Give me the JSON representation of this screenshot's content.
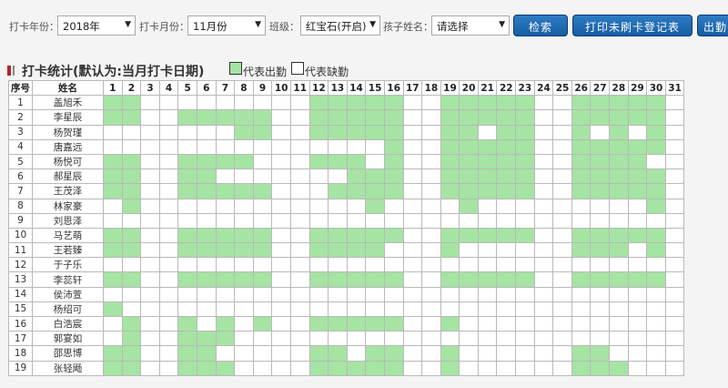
{
  "filters": {
    "year_label": "打卡年份：",
    "year_value": "2018年",
    "month_label": "打卡月份：",
    "month_value": "11月份",
    "class_label": "班级：",
    "class_value": "红宝石(开启)",
    "child_label": "孩子姓名：",
    "child_value": "请选择",
    "search_button": "检索",
    "print_button": "打印未刷卡登记表",
    "export_button": "出勤"
  },
  "section": {
    "title": "打卡统计(默认为:当月打卡日期)",
    "legend_present": "代表出勤",
    "legend_absent": "代表缺勤"
  },
  "colors": {
    "present": "#a5e4a3",
    "absent": "#ffffff",
    "button": "#1f6db8"
  },
  "table": {
    "header_no": "序号",
    "header_name": "姓名",
    "days": [
      "1",
      "2",
      "3",
      "4",
      "5",
      "6",
      "7",
      "8",
      "9",
      "10",
      "11",
      "12",
      "13",
      "14",
      "15",
      "16",
      "17",
      "18",
      "19",
      "20",
      "21",
      "22",
      "23",
      "24",
      "25",
      "26",
      "27",
      "28",
      "29",
      "30",
      "31"
    ],
    "rows": [
      {
        "no": "1",
        "name": "盖旭禾",
        "present": [
          1,
          2,
          12,
          13,
          14,
          15,
          16,
          19,
          20,
          21,
          22,
          23,
          26,
          27,
          28,
          29,
          30
        ]
      },
      {
        "no": "2",
        "name": "李星辰",
        "present": [
          1,
          2,
          5,
          6,
          7,
          8,
          9,
          12,
          13,
          14,
          15,
          16,
          19,
          20,
          21,
          22,
          23,
          26,
          27,
          28,
          29,
          30
        ]
      },
      {
        "no": "3",
        "name": "杨贺瑾",
        "present": [
          8,
          9,
          12,
          13,
          14,
          15,
          16,
          19,
          20,
          22,
          23,
          26,
          28,
          30
        ]
      },
      {
        "no": "4",
        "name": "唐嘉远",
        "present": [
          16,
          19,
          20,
          21,
          22,
          23,
          26,
          27,
          28,
          29,
          30
        ]
      },
      {
        "no": "5",
        "name": "杨悦可",
        "present": [
          1,
          2,
          5,
          6,
          7,
          8,
          12,
          13,
          14,
          16,
          19,
          20,
          21,
          22,
          23,
          26,
          27,
          28,
          29
        ]
      },
      {
        "no": "6",
        "name": "郝星辰",
        "present": [
          1,
          2,
          5,
          6,
          14,
          15,
          16,
          19,
          20,
          21,
          22,
          23,
          26,
          27,
          28,
          29,
          30
        ]
      },
      {
        "no": "7",
        "name": "王茂泽",
        "present": [
          1,
          2,
          5,
          6,
          7,
          8,
          9,
          13,
          14,
          15,
          16,
          19,
          20,
          21,
          22,
          23,
          26,
          27,
          28,
          29,
          30
        ]
      },
      {
        "no": "8",
        "name": "林家豪",
        "present": [
          2,
          15,
          20,
          30
        ]
      },
      {
        "no": "9",
        "name": "刘恩泽",
        "present": []
      },
      {
        "no": "10",
        "name": "马艺萌",
        "present": [
          1,
          2,
          5,
          6,
          7,
          8,
          9,
          12,
          13,
          14,
          15,
          16,
          19,
          20,
          21,
          22,
          23,
          26,
          27,
          28,
          29,
          30
        ]
      },
      {
        "no": "11",
        "name": "王若臻",
        "present": [
          1,
          2,
          5,
          6,
          7,
          8,
          9,
          12,
          13,
          14,
          15,
          19,
          26,
          27,
          28,
          30
        ]
      },
      {
        "no": "12",
        "name": "于子乐",
        "present": []
      },
      {
        "no": "13",
        "name": "李蕊轩",
        "present": [
          1,
          2,
          5,
          6,
          7,
          8,
          9,
          12,
          13,
          14,
          15,
          16,
          19,
          20,
          21,
          22,
          23,
          26,
          27,
          28,
          29,
          30
        ]
      },
      {
        "no": "14",
        "name": "侯沛萱",
        "present": []
      },
      {
        "no": "15",
        "name": "杨绍可",
        "present": [
          1
        ]
      },
      {
        "no": "16",
        "name": "白浩宸",
        "present": [
          2,
          5,
          7,
          9,
          12,
          13,
          14,
          15,
          16,
          19
        ]
      },
      {
        "no": "17",
        "name": "郭宴如",
        "present": [
          2,
          5,
          6,
          7
        ]
      },
      {
        "no": "18",
        "name": "邵思博",
        "present": [
          1,
          2,
          5,
          6,
          12,
          13,
          15,
          16,
          19,
          26,
          27
        ]
      },
      {
        "no": "19",
        "name": "张轻飏",
        "present": [
          1,
          2,
          5,
          6,
          7,
          12,
          13,
          14,
          15,
          16,
          19,
          26,
          27,
          28
        ]
      }
    ]
  }
}
